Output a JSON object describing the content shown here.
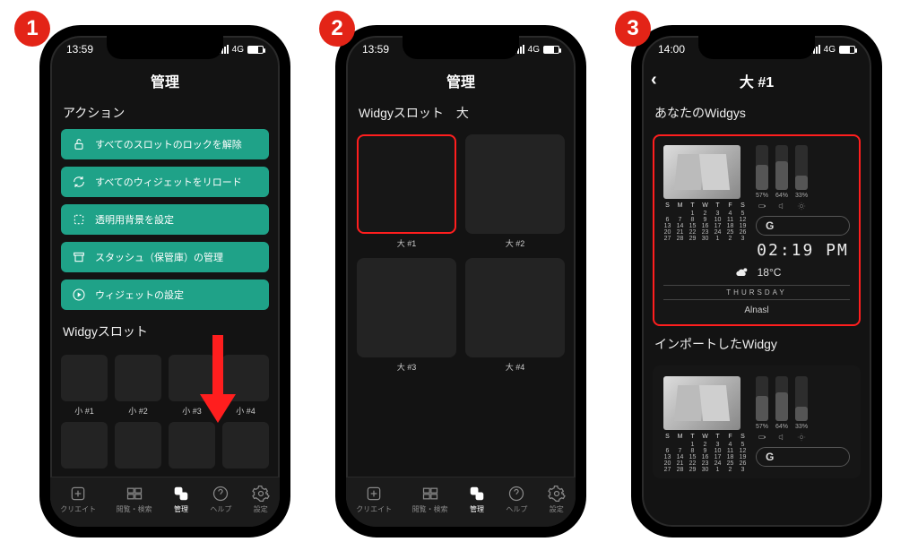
{
  "badges": {
    "one": "1",
    "two": "2",
    "three": "3"
  },
  "status": {
    "time1": "13:59",
    "time2": "13:59",
    "time3": "14:00",
    "net": "4G"
  },
  "phone1": {
    "title": "管理",
    "section_actions": "アクション",
    "actions": [
      {
        "label": "すべてのスロットのロックを解除"
      },
      {
        "label": "すべてのウィジェットをリロード"
      },
      {
        "label": "透明用背景を設定"
      },
      {
        "label": "スタッシュ（保管庫）の管理"
      },
      {
        "label": "ウィジェットの設定"
      }
    ],
    "section_slots": "Widgyスロット",
    "small_slots": [
      "小 #1",
      "小 #2",
      "小 #3",
      "小 #4"
    ]
  },
  "phone2": {
    "title": "管理",
    "section": "Widgyスロット　大",
    "slots": [
      "大 #1",
      "大 #2",
      "大 #3",
      "大 #4"
    ]
  },
  "phone3": {
    "title": "大 #1",
    "section_your": "あなたのWidgys",
    "section_imported": "インポートしたWidgy",
    "sliders": [
      {
        "pct": "57%"
      },
      {
        "pct": "64%"
      },
      {
        "pct": "33%"
      }
    ],
    "search_initial": "G",
    "clock": "02:19 PM",
    "temp": "18°C",
    "dayname": "THURSDAY",
    "widgy_name": "Alnasl",
    "cal_header": [
      "S",
      "M",
      "T",
      "W",
      "T",
      "F",
      "S"
    ],
    "cal_rows": [
      [
        "",
        "",
        "1",
        "2",
        "3",
        "4",
        "5"
      ],
      [
        "6",
        "7",
        "8",
        "9",
        "10",
        "11",
        "12"
      ],
      [
        "13",
        "14",
        "15",
        "16",
        "17",
        "18",
        "19"
      ],
      [
        "20",
        "21",
        "22",
        "23",
        "24",
        "25",
        "26"
      ],
      [
        "27",
        "28",
        "29",
        "30",
        "1",
        "2",
        "3"
      ]
    ]
  },
  "tabs": [
    {
      "label": "クリエイト"
    },
    {
      "label": "閲覧・検索"
    },
    {
      "label": "管理"
    },
    {
      "label": "ヘルプ"
    },
    {
      "label": "設定"
    }
  ]
}
